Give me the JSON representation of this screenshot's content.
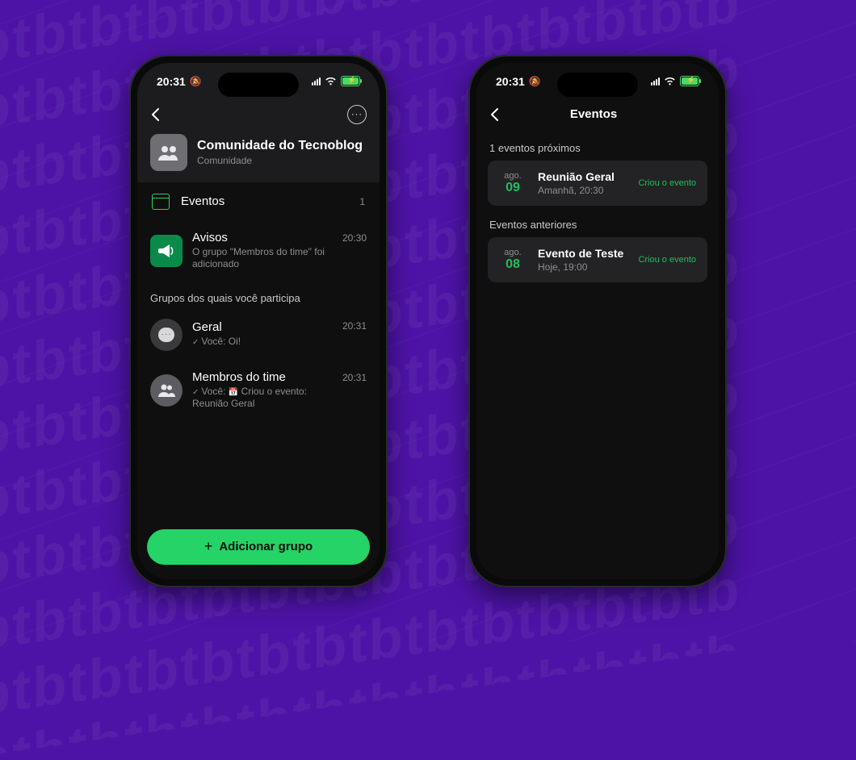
{
  "status": {
    "time": "20:31"
  },
  "phone1": {
    "community": {
      "title": "Comunidade do Tecnoblog",
      "subtitle": "Comunidade"
    },
    "events_row": {
      "label": "Eventos",
      "count": "1"
    },
    "avisos": {
      "title": "Avisos",
      "subtitle": "O grupo \"Membros do time\" foi adicionado",
      "time": "20:30"
    },
    "section_label": "Grupos dos quais você participa",
    "groups": [
      {
        "title": "Geral",
        "check": "✓",
        "you_label": "Você:",
        "message": "Oi!",
        "time": "20:31"
      },
      {
        "title": "Membros do time",
        "check": "✓",
        "you_label": "Você:",
        "message": "Criou o evento: Reunião Geral",
        "time": "20:31"
      }
    ],
    "add_button": "Adicionar grupo"
  },
  "phone2": {
    "title": "Eventos",
    "upcoming_label": "1 eventos próximos",
    "past_label": "Eventos anteriores",
    "upcoming": {
      "month": "ago.",
      "day": "09",
      "title": "Reunião Geral",
      "subtitle": "Amanhã, 20:30",
      "badge": "Criou o evento"
    },
    "past": {
      "month": "ago.",
      "day": "08",
      "title": "Evento de Teste",
      "subtitle": "Hoje, 19:00",
      "badge": "Criou o evento"
    }
  }
}
